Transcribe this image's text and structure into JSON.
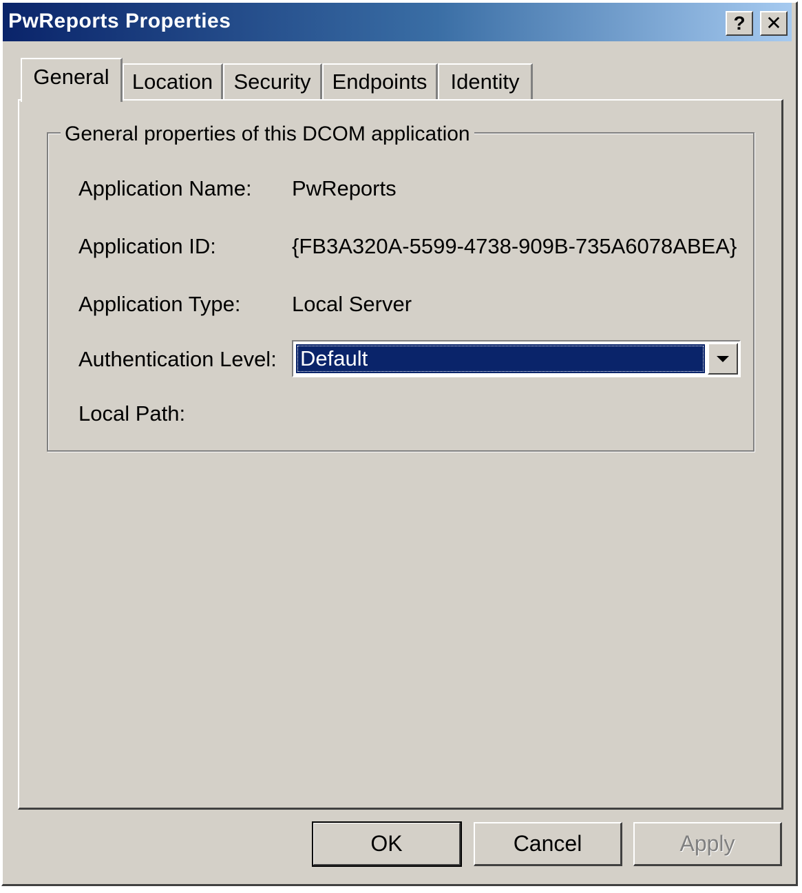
{
  "window": {
    "title": "PwReports Properties",
    "help_glyph": "?",
    "close_glyph": "✕"
  },
  "tabs": [
    {
      "label": "General",
      "active": true
    },
    {
      "label": "Location",
      "active": false
    },
    {
      "label": "Security",
      "active": false
    },
    {
      "label": "Endpoints",
      "active": false
    },
    {
      "label": "Identity",
      "active": false
    }
  ],
  "group": {
    "title": "General properties of this DCOM application",
    "rows": [
      {
        "label": "Application Name:",
        "value": "PwReports"
      },
      {
        "label": "Application ID:",
        "value": "{FB3A320A-5599-4738-909B-735A6078ABEA}"
      },
      {
        "label": "Application Type:",
        "value": "Local Server"
      },
      {
        "label": "Authentication Level:"
      },
      {
        "label": "Local Path:",
        "value": ""
      }
    ],
    "auth_level": {
      "selected": "Default"
    }
  },
  "buttons": {
    "ok": "OK",
    "cancel": "Cancel",
    "apply": "Apply"
  },
  "colors": {
    "dialog_bg": "#d4d0c8",
    "title_gradient_start": "#0a246a",
    "title_gradient_end": "#a6caf0",
    "selection": "#0a246a"
  },
  "icons": {
    "help": "help-icon",
    "close": "close-icon",
    "dropdown": "chevron-down-icon"
  }
}
